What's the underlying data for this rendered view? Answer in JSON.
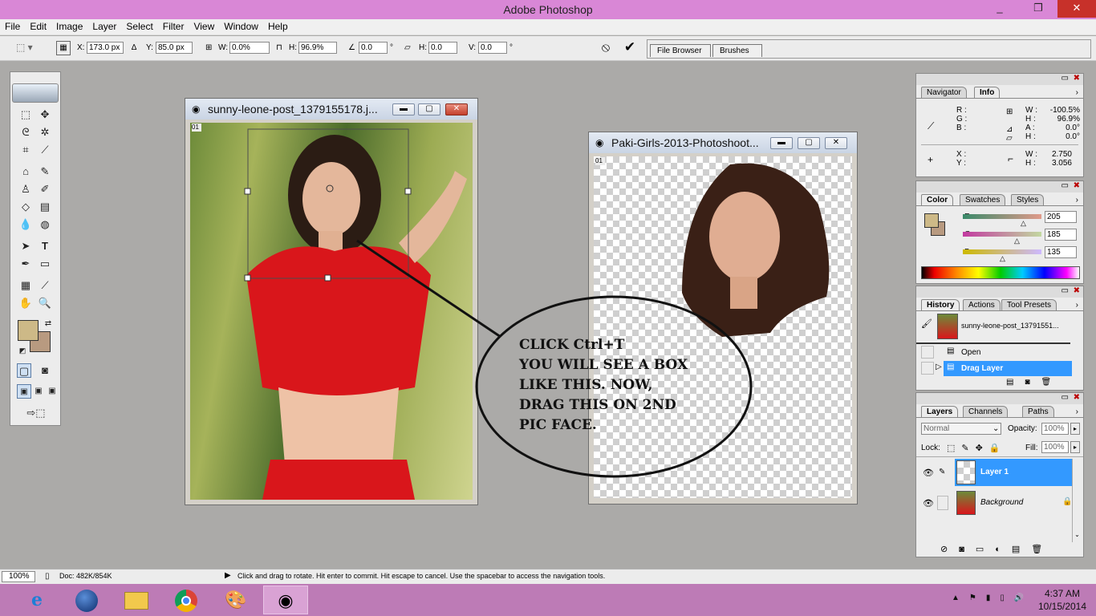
{
  "window": {
    "title": "Adobe Photoshop",
    "controls": [
      "_",
      "❐",
      "✕"
    ]
  },
  "menu": [
    "File",
    "Edit",
    "Image",
    "Layer",
    "Select",
    "Filter",
    "View",
    "Window",
    "Help"
  ],
  "options_bar": {
    "x_label": "X:",
    "x_value": "173.0 px",
    "y_label": "Y:",
    "y_value": "85.0 px",
    "w_label": "W:",
    "w_value": "0.0%",
    "h_label": "H:",
    "h_value": "96.9%",
    "angle_value": "0.0",
    "angle_unit": "°",
    "skew_h_label": "H:",
    "skew_h_value": "0.0",
    "skew_v_label": "V:",
    "skew_v_value": "0.0",
    "degree": "°",
    "well_tabs": [
      "File Browser",
      "Brushes"
    ]
  },
  "doc1": {
    "title": "sunny-leone-post_1379155178.j...",
    "marker": "01"
  },
  "doc2": {
    "title": "Paki-Girls-2013-Photoshoot...",
    "marker": "01"
  },
  "annotation": {
    "text": "CLICK Ctrl+T\nYOU WILL SEE A BOX\nLIKE THIS. NOW,\nDRAG THIS ON 2ND\nPIC FACE."
  },
  "info_palette": {
    "tabs": [
      "Navigator",
      "Info"
    ],
    "active_tab": "Info",
    "r_label": "R :",
    "g_label": "G :",
    "b_label": "B :",
    "w_label": "W :",
    "w_value": "-100.5%",
    "h_label": "H :",
    "h_value": "96.9%",
    "a_label": "A :",
    "a_value": "0.0°",
    "h2_label": "H :",
    "h2_value": "0.0°",
    "x_label": "X :",
    "y_label": "Y :",
    "w2_label": "W :",
    "w2_value": "2.750",
    "h3_label": "H :",
    "h3_value": "3.056"
  },
  "color_palette": {
    "tabs": [
      "Color",
      "Swatches",
      "Styles"
    ],
    "active_tab": "Color",
    "r_label": "R",
    "r_value": "205",
    "g_label": "G",
    "g_value": "185",
    "b_label": "B",
    "b_value": "135",
    "foreground": "#cdb987",
    "background": "#b89a80"
  },
  "history_palette": {
    "tabs": [
      "History",
      "Actions",
      "Tool Presets"
    ],
    "active_tab": "History",
    "snapshot": "sunny-leone-post_13791551...",
    "items": [
      "Open",
      "Drag Layer"
    ],
    "selected": "Drag Layer"
  },
  "layers_palette": {
    "tabs": [
      "Layers",
      "Channels",
      "Paths"
    ],
    "active_tab": "Layers",
    "blend_mode": "Normal",
    "opacity_label": "Opacity:",
    "opacity_value": "100%",
    "lock_label": "Lock:",
    "fill_label": "Fill:",
    "fill_value": "100%",
    "layers": [
      "Layer 1",
      "Background"
    ],
    "selected": "Layer 1"
  },
  "status_bar": {
    "zoom": "100%",
    "doc": "Doc: 482K/854K",
    "hint": "Click and drag to rotate. Hit enter to commit. Hit escape to cancel. Use the spacebar to access the navigation tools."
  },
  "taskbar": {
    "time": "4:37 AM",
    "date": "10/15/2014",
    "tray_icons": [
      "▲",
      "⚑",
      "▮▯",
      "🔊"
    ]
  },
  "colors": {
    "title_bar": "#d987d6",
    "taskbar": "#bd7bb6",
    "selection_blue": "#3399ff"
  }
}
